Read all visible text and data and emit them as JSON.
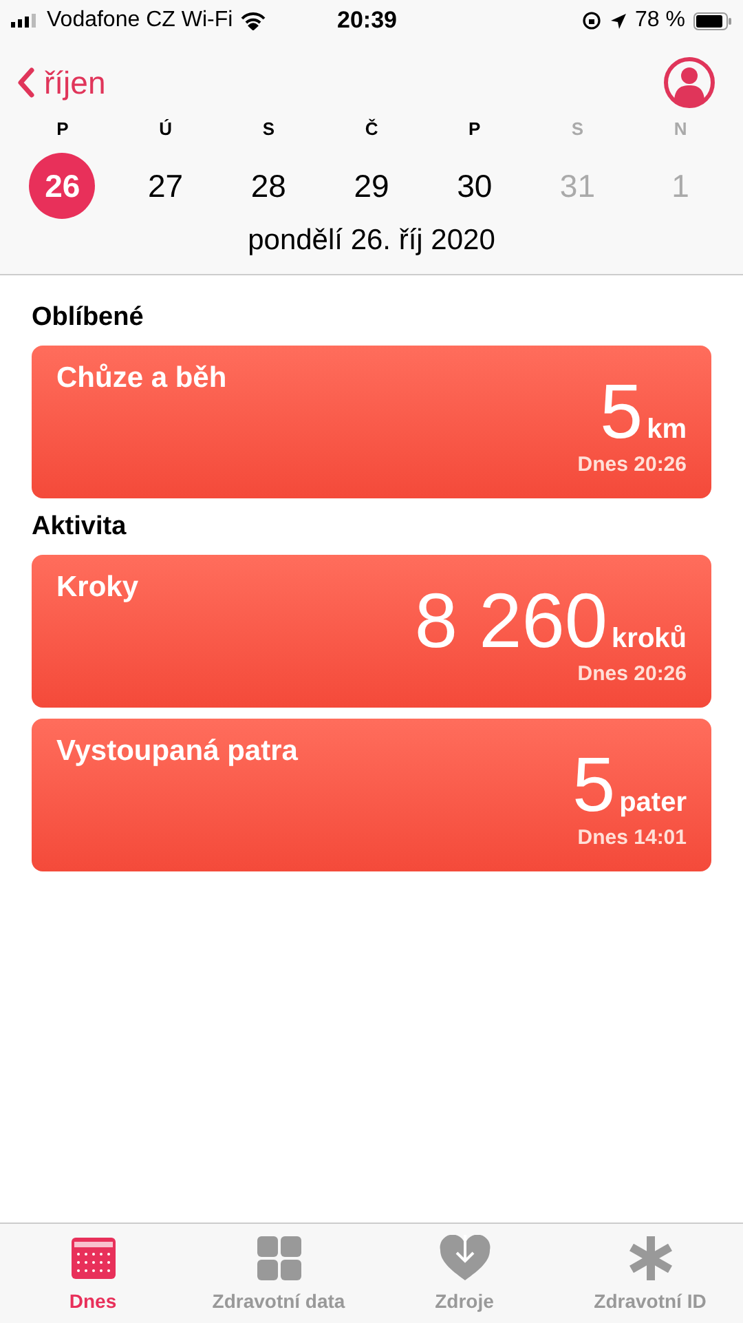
{
  "status_bar": {
    "carrier": "Vodafone CZ Wi-Fi",
    "time": "20:39",
    "battery_percent": "78 %"
  },
  "nav": {
    "back_label": "říjen"
  },
  "week": [
    {
      "letter": "P",
      "day": "26",
      "selected": true,
      "weekend": false
    },
    {
      "letter": "Ú",
      "day": "27",
      "selected": false,
      "weekend": false
    },
    {
      "letter": "S",
      "day": "28",
      "selected": false,
      "weekend": false
    },
    {
      "letter": "Č",
      "day": "29",
      "selected": false,
      "weekend": false
    },
    {
      "letter": "P",
      "day": "30",
      "selected": false,
      "weekend": false
    },
    {
      "letter": "S",
      "day": "31",
      "selected": false,
      "weekend": true
    },
    {
      "letter": "N",
      "day": "1",
      "selected": false,
      "weekend": true
    }
  ],
  "date_label": "pondělí 26. říj 2020",
  "sections": [
    {
      "title": "Oblíbené",
      "cards": [
        {
          "title": "Chůze a běh",
          "value": "5",
          "unit": "km",
          "time": "Dnes 20:26"
        }
      ]
    },
    {
      "title": "Aktivita",
      "cards": [
        {
          "title": "Kroky",
          "value": "8 260",
          "unit": "kroků",
          "time": "Dnes 20:26"
        },
        {
          "title": "Vystoupaná patra",
          "value": "5",
          "unit": "pater",
          "time": "Dnes 14:01"
        }
      ]
    }
  ],
  "tabs": [
    {
      "kind": "today",
      "label": "Dnes",
      "selected": true
    },
    {
      "kind": "data",
      "label": "Zdravotní data",
      "selected": false
    },
    {
      "kind": "sources",
      "label": "Zdroje",
      "selected": false
    },
    {
      "kind": "id",
      "label": "Zdravotní ID",
      "selected": false
    }
  ]
}
